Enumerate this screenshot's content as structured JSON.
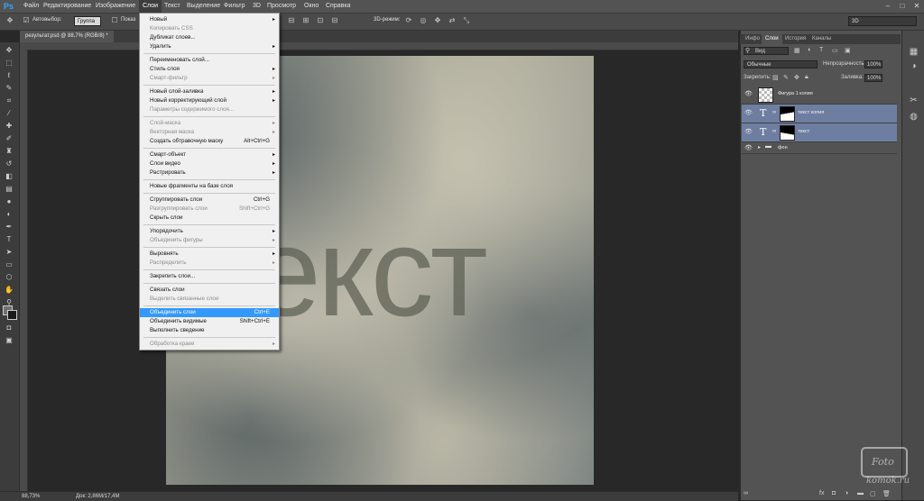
{
  "app": {
    "logo": "Ps"
  },
  "menubar": {
    "items": [
      "Файл",
      "Редактирование",
      "Изображение",
      "Слои",
      "Текст",
      "Выделение",
      "Фильтр",
      "3D",
      "Просмотр",
      "Окно",
      "Справка"
    ],
    "active": "Слои"
  },
  "options": {
    "autoselect_label": "Автовыбор:",
    "autoselect_value": "Группа",
    "show_label": "Показ",
    "mode3d_label": "3D-режим:",
    "workspace_value": "3D"
  },
  "document": {
    "tab_title": "результат.psd @ 88,7% (RGB/8) *",
    "canvas_text": "екст"
  },
  "status": {
    "zoom": "88,73%",
    "doc": "Док: 2,86M/17,4M"
  },
  "layer_menu": {
    "items": [
      {
        "label": "Новый",
        "shortcut": "",
        "submenu": true,
        "disabled": false
      },
      {
        "label": "Копировать CSS",
        "shortcut": "",
        "submenu": false,
        "disabled": true
      },
      {
        "label": "Дубликат слоев...",
        "shortcut": "",
        "submenu": false,
        "disabled": false
      },
      {
        "label": "Удалить",
        "shortcut": "",
        "submenu": true,
        "disabled": false
      },
      {
        "sep": true
      },
      {
        "label": "Переименовать слой...",
        "shortcut": "",
        "submenu": false,
        "disabled": false
      },
      {
        "label": "Стиль слоя",
        "shortcut": "",
        "submenu": true,
        "disabled": false
      },
      {
        "label": "Смарт-фильтр",
        "shortcut": "",
        "submenu": true,
        "disabled": true
      },
      {
        "sep": true
      },
      {
        "label": "Новый слой-заливка",
        "shortcut": "",
        "submenu": true,
        "disabled": false
      },
      {
        "label": "Новый корректирующий слой",
        "shortcut": "",
        "submenu": true,
        "disabled": false
      },
      {
        "label": "Параметры содержимого слоя...",
        "shortcut": "",
        "submenu": false,
        "disabled": true
      },
      {
        "sep": true
      },
      {
        "label": "Слой-маска",
        "shortcut": "",
        "submenu": true,
        "disabled": true
      },
      {
        "label": "Векторная маска",
        "shortcut": "",
        "submenu": true,
        "disabled": true
      },
      {
        "label": "Создать обтравочную маску",
        "shortcut": "Alt+Ctrl+G",
        "submenu": false,
        "disabled": false
      },
      {
        "sep": true
      },
      {
        "label": "Смарт-объект",
        "shortcut": "",
        "submenu": true,
        "disabled": false
      },
      {
        "label": "Слои видео",
        "shortcut": "",
        "submenu": true,
        "disabled": false
      },
      {
        "label": "Растрировать",
        "shortcut": "",
        "submenu": true,
        "disabled": false
      },
      {
        "sep": true
      },
      {
        "label": "Новые фрагменты на базе слоя",
        "shortcut": "",
        "submenu": false,
        "disabled": false
      },
      {
        "sep": true
      },
      {
        "label": "Сгруппировать слои",
        "shortcut": "Ctrl+G",
        "submenu": false,
        "disabled": false
      },
      {
        "label": "Разгруппировать слои",
        "shortcut": "Shift+Ctrl+G",
        "submenu": false,
        "disabled": true
      },
      {
        "label": "Скрыть слои",
        "shortcut": "",
        "submenu": false,
        "disabled": false
      },
      {
        "sep": true
      },
      {
        "label": "Упорядочить",
        "shortcut": "",
        "submenu": true,
        "disabled": false
      },
      {
        "label": "Объединить фигуры",
        "shortcut": "",
        "submenu": true,
        "disabled": true
      },
      {
        "sep": true
      },
      {
        "label": "Выровнять",
        "shortcut": "",
        "submenu": true,
        "disabled": false
      },
      {
        "label": "Распределить",
        "shortcut": "",
        "submenu": true,
        "disabled": true
      },
      {
        "sep": true
      },
      {
        "label": "Закрепить слои...",
        "shortcut": "",
        "submenu": false,
        "disabled": false
      },
      {
        "sep": true
      },
      {
        "label": "Связать слои",
        "shortcut": "",
        "submenu": false,
        "disabled": false
      },
      {
        "label": "Выделить связанные слои",
        "shortcut": "",
        "submenu": false,
        "disabled": true
      },
      {
        "sep": true
      },
      {
        "label": "Объединить слои",
        "shortcut": "Ctrl+E",
        "submenu": false,
        "disabled": false,
        "highlight": true
      },
      {
        "label": "Объединить видимые",
        "shortcut": "Shift+Ctrl+E",
        "submenu": false,
        "disabled": false
      },
      {
        "label": "Выполнить сведение",
        "shortcut": "",
        "submenu": false,
        "disabled": false
      },
      {
        "sep": true
      },
      {
        "label": "Обработка краев",
        "shortcut": "",
        "submenu": true,
        "disabled": true
      }
    ]
  },
  "panel": {
    "tabs": [
      "Инфо",
      "Слои",
      "История",
      "Каналы"
    ],
    "active_tab": "Слои",
    "filter_value": "Вид",
    "blend_mode": "Обычные",
    "opacity_label": "Непрозрачность:",
    "opacity_value": "100%",
    "lock_label": "Закрепить:",
    "fill_label": "Заливка:",
    "fill_value": "100%",
    "layers": [
      {
        "name": "Фигура 1 копия",
        "type": "shape",
        "selected": false
      },
      {
        "name": "текст копия",
        "type": "text",
        "selected": true
      },
      {
        "name": "текст",
        "type": "text",
        "selected": true
      },
      {
        "name": "фон",
        "type": "group",
        "selected": false
      }
    ]
  },
  "watermark": {
    "line1": "Foto",
    "line2": "komok.ru"
  },
  "colors": {
    "accent": "#31a8ff",
    "menu_highlight": "#3399ff",
    "layer_selected": "#6d7ea1"
  }
}
